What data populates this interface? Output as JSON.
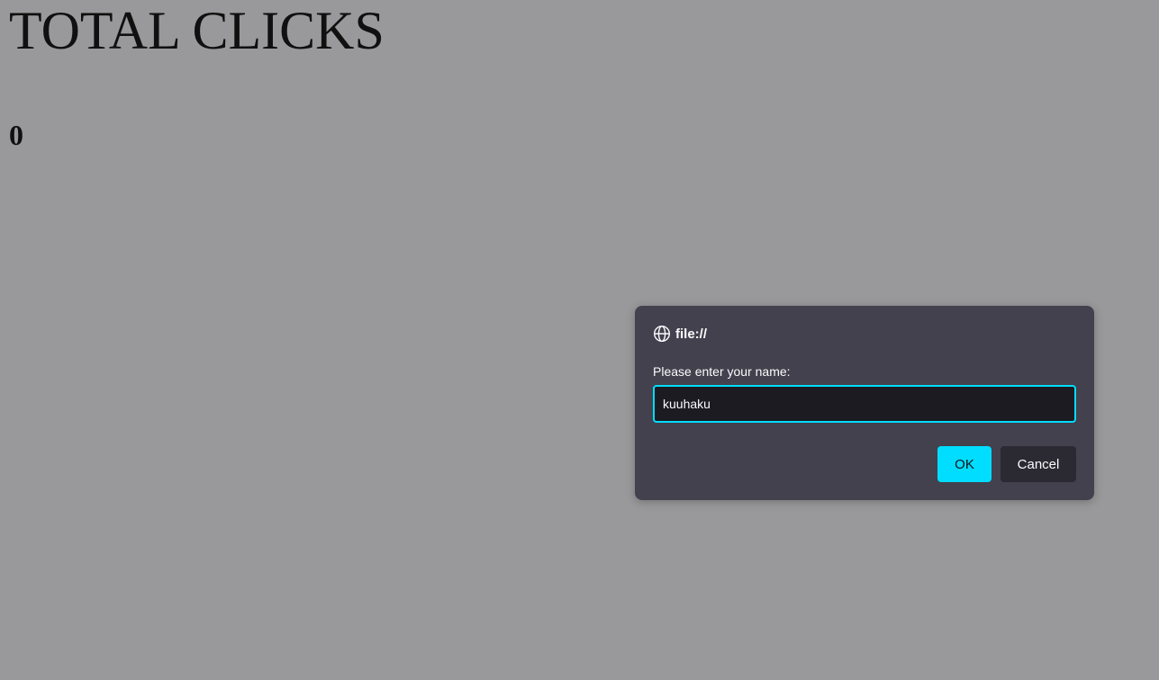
{
  "page": {
    "title": "TOTAL CLICKS",
    "count": "0"
  },
  "dialog": {
    "origin": "file://",
    "origin_icon": "globe-icon",
    "prompt": "Please enter your name:",
    "input_value": "kuuhaku",
    "ok_label": "OK",
    "cancel_label": "Cancel"
  },
  "colors": {
    "page_background": "#99999b",
    "dialog_background": "#42414d",
    "accent": "#00ddff",
    "input_background": "#1c1b22",
    "cancel_background": "#2b2a33"
  }
}
